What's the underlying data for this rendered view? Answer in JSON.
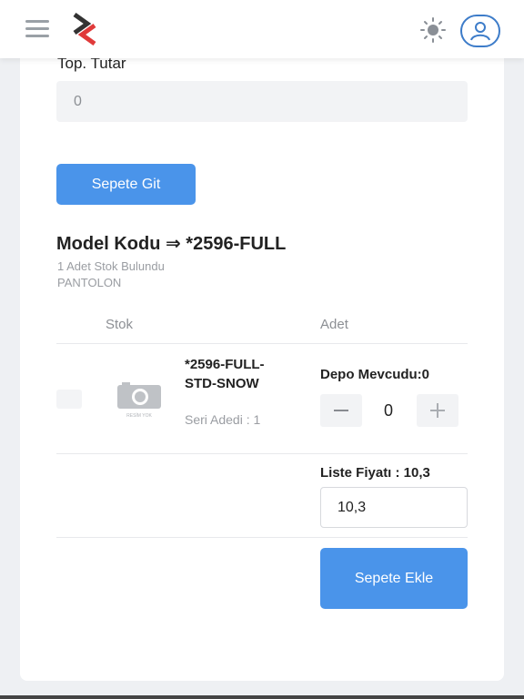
{
  "header": {
    "menu_icon": "hamburger-menu-icon",
    "logo_icon": "brand-logo",
    "theme_icon": "sun-icon",
    "profile_icon": "user-icon"
  },
  "form": {
    "total_label": "Top. Tutar",
    "total_value": "0",
    "go_to_cart_label": "Sepete Git"
  },
  "model": {
    "title": "Model Kodu ⇒ *2596-FULL",
    "stock_found": "1 Adet Stok Bulundu",
    "category": "PANTOLON"
  },
  "table": {
    "columns": [
      "Stok",
      "Adet"
    ],
    "rows": [
      {
        "image_text": "RESİM YOK",
        "product_code": "*2596-FULL-STD-SNOW",
        "serial_label": "Seri Adedi : 1",
        "stock_label": "Depo Mevcudu:0",
        "quantity": "0",
        "minus_symbol": "−",
        "plus_symbol": "+",
        "price_label": "Liste Fiyatı : 10,3",
        "price_value": "10,3",
        "add_label": "Sepete Ekle"
      }
    ]
  },
  "colors": {
    "accent": "#4a94ea",
    "profile_border": "#3d7cc9",
    "logo_dark": "#333333",
    "logo_red": "#e03a3a"
  }
}
